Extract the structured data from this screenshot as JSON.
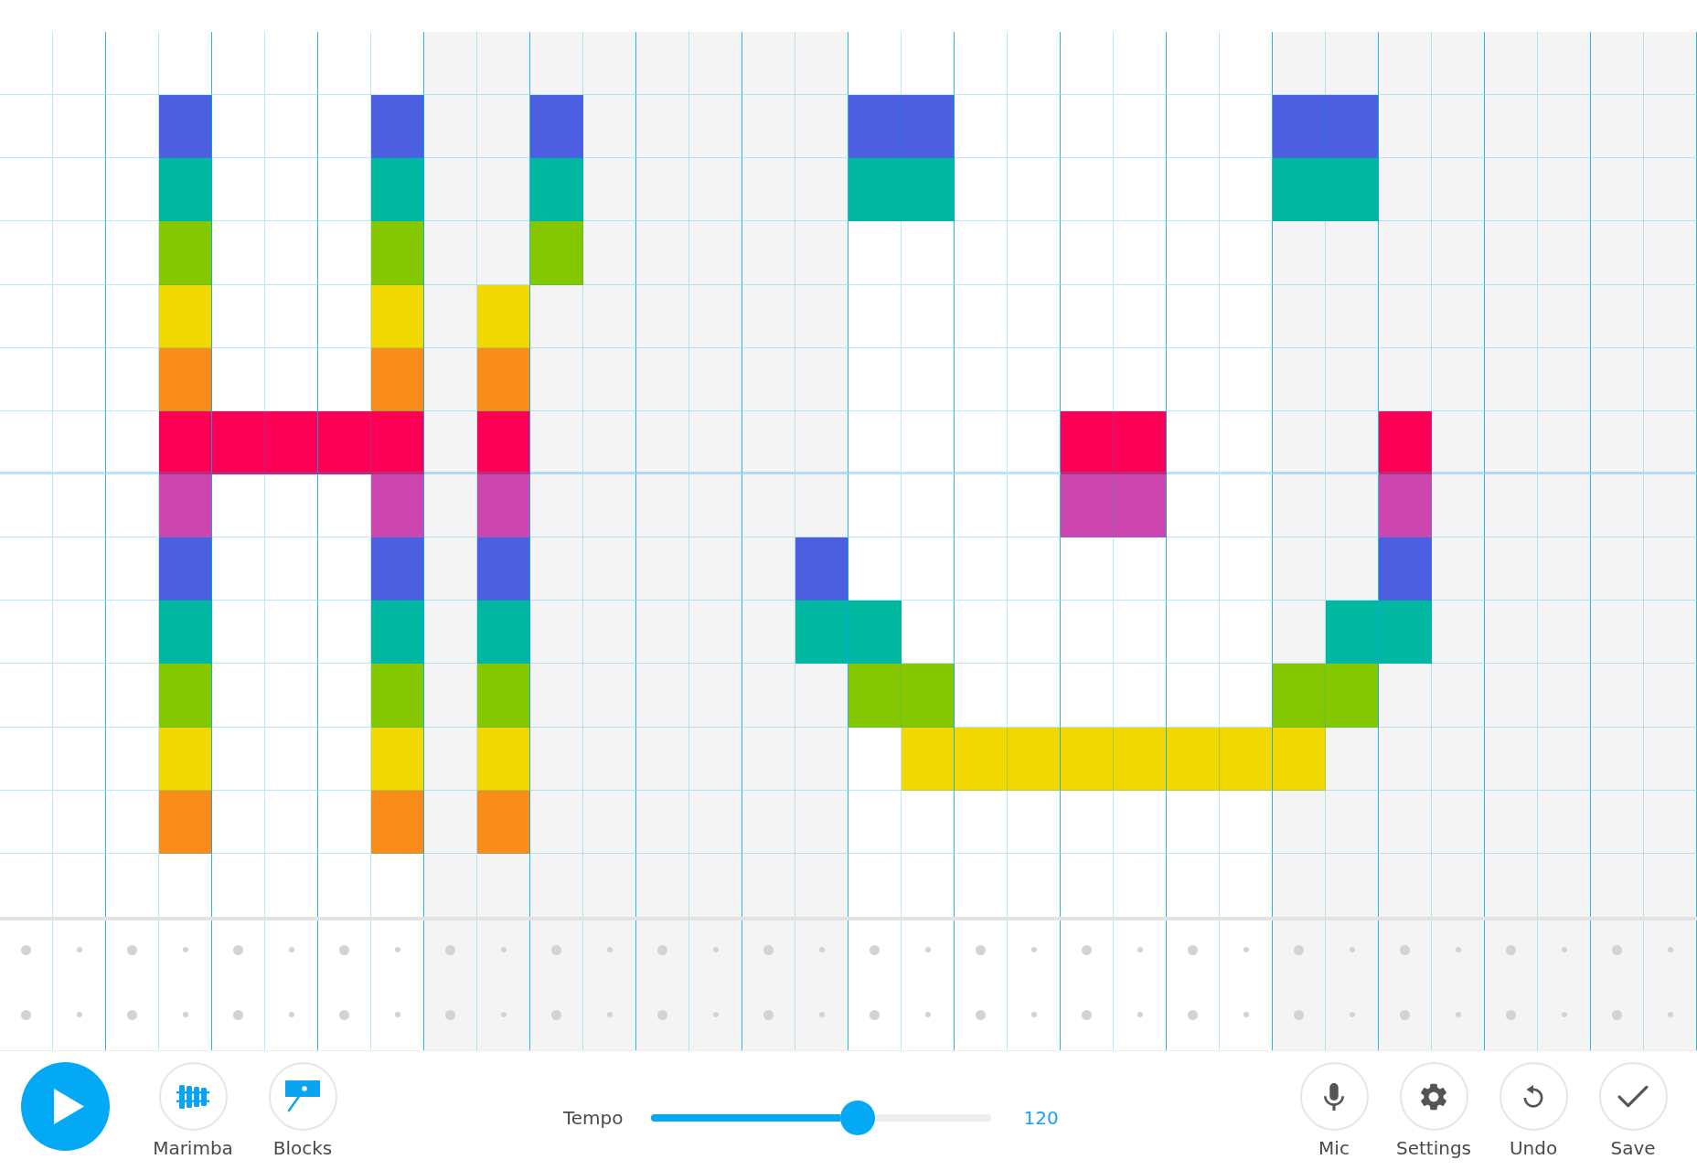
{
  "melody": {
    "rows": [
      {
        "on": [
          false,
          false,
          false,
          false,
          false,
          false,
          false,
          false,
          false,
          false,
          false,
          false,
          false,
          false,
          false,
          false,
          false,
          false,
          false,
          false,
          false,
          false,
          false,
          false,
          false,
          false,
          false,
          false,
          false,
          false,
          false,
          false
        ]
      },
      {
        "color": "#4b5fe0",
        "on": [
          false,
          false,
          false,
          true,
          false,
          false,
          false,
          true,
          false,
          false,
          true,
          false,
          false,
          false,
          false,
          false,
          true,
          true,
          false,
          false,
          false,
          false,
          false,
          false,
          true,
          true,
          false,
          false,
          false,
          false,
          false,
          false
        ]
      },
      {
        "color": "#00b8a0",
        "on": [
          false,
          false,
          false,
          true,
          false,
          false,
          false,
          true,
          false,
          false,
          true,
          false,
          false,
          false,
          false,
          false,
          true,
          true,
          false,
          false,
          false,
          false,
          false,
          false,
          true,
          true,
          false,
          false,
          false,
          false,
          false,
          false
        ]
      },
      {
        "color": "#85c800",
        "on": [
          false,
          false,
          false,
          true,
          false,
          false,
          false,
          true,
          false,
          false,
          true,
          false,
          false,
          false,
          false,
          false,
          false,
          false,
          false,
          false,
          false,
          false,
          false,
          false,
          false,
          false,
          false,
          false,
          false,
          false,
          false,
          false
        ]
      },
      {
        "color": "#f0d800",
        "on": [
          false,
          false,
          false,
          true,
          false,
          false,
          false,
          true,
          false,
          true,
          false,
          false,
          false,
          false,
          false,
          false,
          false,
          false,
          false,
          false,
          false,
          false,
          false,
          false,
          false,
          false,
          false,
          false,
          false,
          false,
          false,
          false
        ]
      },
      {
        "color": "#fa8d1a",
        "on": [
          false,
          false,
          false,
          true,
          false,
          false,
          false,
          true,
          false,
          true,
          false,
          false,
          false,
          false,
          false,
          false,
          false,
          false,
          false,
          false,
          false,
          false,
          false,
          false,
          false,
          false,
          false,
          false,
          false,
          false,
          false,
          false
        ]
      },
      {
        "color": "#fb0055",
        "on": [
          false,
          false,
          false,
          true,
          true,
          true,
          true,
          true,
          false,
          true,
          false,
          false,
          false,
          false,
          false,
          false,
          false,
          false,
          false,
          false,
          true,
          true,
          false,
          false,
          false,
          false,
          true,
          false,
          false,
          false,
          false,
          false
        ]
      },
      {
        "color": "#cd45ae",
        "on": [
          false,
          false,
          false,
          true,
          false,
          false,
          false,
          true,
          false,
          true,
          false,
          false,
          false,
          false,
          false,
          false,
          false,
          false,
          false,
          false,
          true,
          true,
          false,
          false,
          false,
          false,
          true,
          false,
          false,
          false,
          false,
          false
        ]
      },
      {
        "color": "#4b5fe0",
        "on": [
          false,
          false,
          false,
          true,
          false,
          false,
          false,
          true,
          false,
          true,
          false,
          false,
          false,
          false,
          false,
          true,
          false,
          false,
          false,
          false,
          false,
          false,
          false,
          false,
          false,
          false,
          true,
          false,
          false,
          false,
          false,
          false
        ]
      },
      {
        "color": "#00b8a0",
        "on": [
          false,
          false,
          false,
          true,
          false,
          false,
          false,
          true,
          false,
          true,
          false,
          false,
          false,
          false,
          false,
          true,
          true,
          false,
          false,
          false,
          false,
          false,
          false,
          false,
          false,
          true,
          true,
          false,
          false,
          false,
          false,
          false
        ]
      },
      {
        "color": "#85c800",
        "on": [
          false,
          false,
          false,
          true,
          false,
          false,
          false,
          true,
          false,
          true,
          false,
          false,
          false,
          false,
          false,
          false,
          true,
          true,
          false,
          false,
          false,
          false,
          false,
          false,
          true,
          true,
          false,
          false,
          false,
          false,
          false,
          false
        ]
      },
      {
        "color": "#f0d800",
        "on": [
          false,
          false,
          false,
          true,
          false,
          false,
          false,
          true,
          false,
          true,
          false,
          false,
          false,
          false,
          false,
          false,
          false,
          true,
          true,
          true,
          true,
          true,
          true,
          true,
          true,
          false,
          false,
          false,
          false,
          false,
          false,
          false
        ]
      },
      {
        "color": "#fa8d1a",
        "on": [
          false,
          false,
          false,
          true,
          false,
          false,
          false,
          true,
          false,
          true,
          false,
          false,
          false,
          false,
          false,
          false,
          false,
          false,
          false,
          false,
          false,
          false,
          false,
          false,
          false,
          false,
          false,
          false,
          false,
          false,
          false,
          false
        ]
      },
      {
        "on": [
          false,
          false,
          false,
          false,
          false,
          false,
          false,
          false,
          false,
          false,
          false,
          false,
          false,
          false,
          false,
          false,
          false,
          false,
          false,
          false,
          false,
          false,
          false,
          false,
          false,
          false,
          false,
          false,
          false,
          false,
          false,
          false
        ]
      }
    ]
  },
  "percussion": {
    "rows": [
      {
        "on": [
          false,
          false,
          false,
          false,
          false,
          false,
          false,
          false,
          false,
          false,
          false,
          false,
          false,
          false,
          false,
          false,
          false,
          false,
          false,
          false,
          false,
          false,
          false,
          false,
          false,
          false,
          false,
          false,
          false,
          false,
          false,
          false
        ]
      },
      {
        "on": [
          false,
          false,
          false,
          false,
          false,
          false,
          false,
          false,
          false,
          false,
          false,
          false,
          false,
          false,
          false,
          false,
          false,
          false,
          false,
          false,
          false,
          false,
          false,
          false,
          false,
          false,
          false,
          false,
          false,
          false,
          false,
          false
        ]
      }
    ]
  },
  "toolbar": {
    "instruments": [
      {
        "kind": "marimba",
        "label": "Marimba"
      },
      {
        "kind": "blocks",
        "label": "Blocks"
      }
    ],
    "tempo": {
      "label": "Tempo",
      "level": 0.61,
      "value": "120"
    },
    "actions": [
      {
        "kind": "mic",
        "label": "Mic"
      },
      {
        "kind": "settings",
        "label": "Settings"
      },
      {
        "kind": "undo",
        "label": "Undo"
      },
      {
        "kind": "save",
        "label": "Save"
      }
    ]
  }
}
